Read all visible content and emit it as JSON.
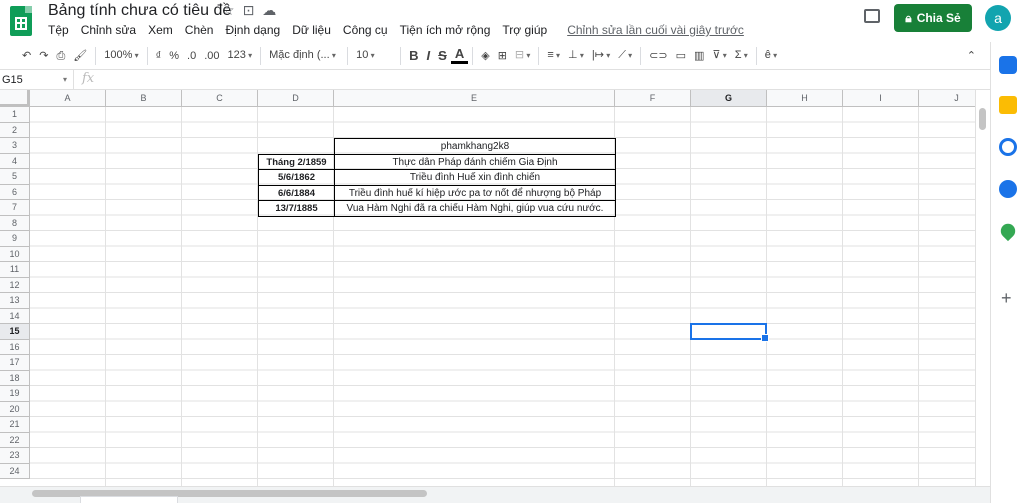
{
  "title": "Bảng tính chưa có tiêu đề",
  "menu": [
    "Tệp",
    "Chỉnh sửa",
    "Xem",
    "Chèn",
    "Định dạng",
    "Dữ liệu",
    "Công cụ",
    "Tiện ích mở rộng",
    "Trợ giúp"
  ],
  "last_edit": "Chỉnh sửa lần cuối vài giây trước",
  "share_label": "Chia Sẻ",
  "avatar_letter": "a",
  "toolbar": {
    "zoom": "100%",
    "currency": "₫",
    "percent": "%",
    "dec_less": ".0",
    "dec_more": ".00",
    "number_format": "123",
    "font": "Mặc định (...",
    "font_size": "10",
    "bold": "B",
    "italic": "I",
    "strike": "S",
    "text_color": "A",
    "sum": "Σ"
  },
  "name_box": "G15",
  "fx": "fx",
  "columns": [
    "A",
    "B",
    "C",
    "D",
    "E",
    "F",
    "G",
    "H",
    "I",
    "J"
  ],
  "rows": [
    "1",
    "2",
    "3",
    "4",
    "5",
    "6",
    "7",
    "8",
    "9",
    "10",
    "11",
    "12",
    "13",
    "14",
    "15",
    "16",
    "17",
    "18",
    "19",
    "20",
    "21",
    "22",
    "23",
    "24"
  ],
  "selected_cell": {
    "col": "G",
    "row": "15"
  },
  "cells": {
    "E3": "phamkhang2k8",
    "D4": "Tháng 2/1859",
    "E4": "Thực dân Pháp đánh chiếm Gia Định",
    "D5": "5/6/1862",
    "E5": "Triều đình Huế xin đình chiến",
    "D6": "6/6/1884",
    "E6": "Triều đình huế kí hiệp ước pa tơ nốt để nhượng bộ Pháp",
    "D7": "13/7/1885",
    "E7": "Vua Hàm Nghi đã ra chiếu Hàm Nghi, giúp vua cứu nước."
  },
  "colors": {
    "brand_green": "#0f9d58",
    "share_green": "#188038",
    "selection_blue": "#1a73e8"
  }
}
